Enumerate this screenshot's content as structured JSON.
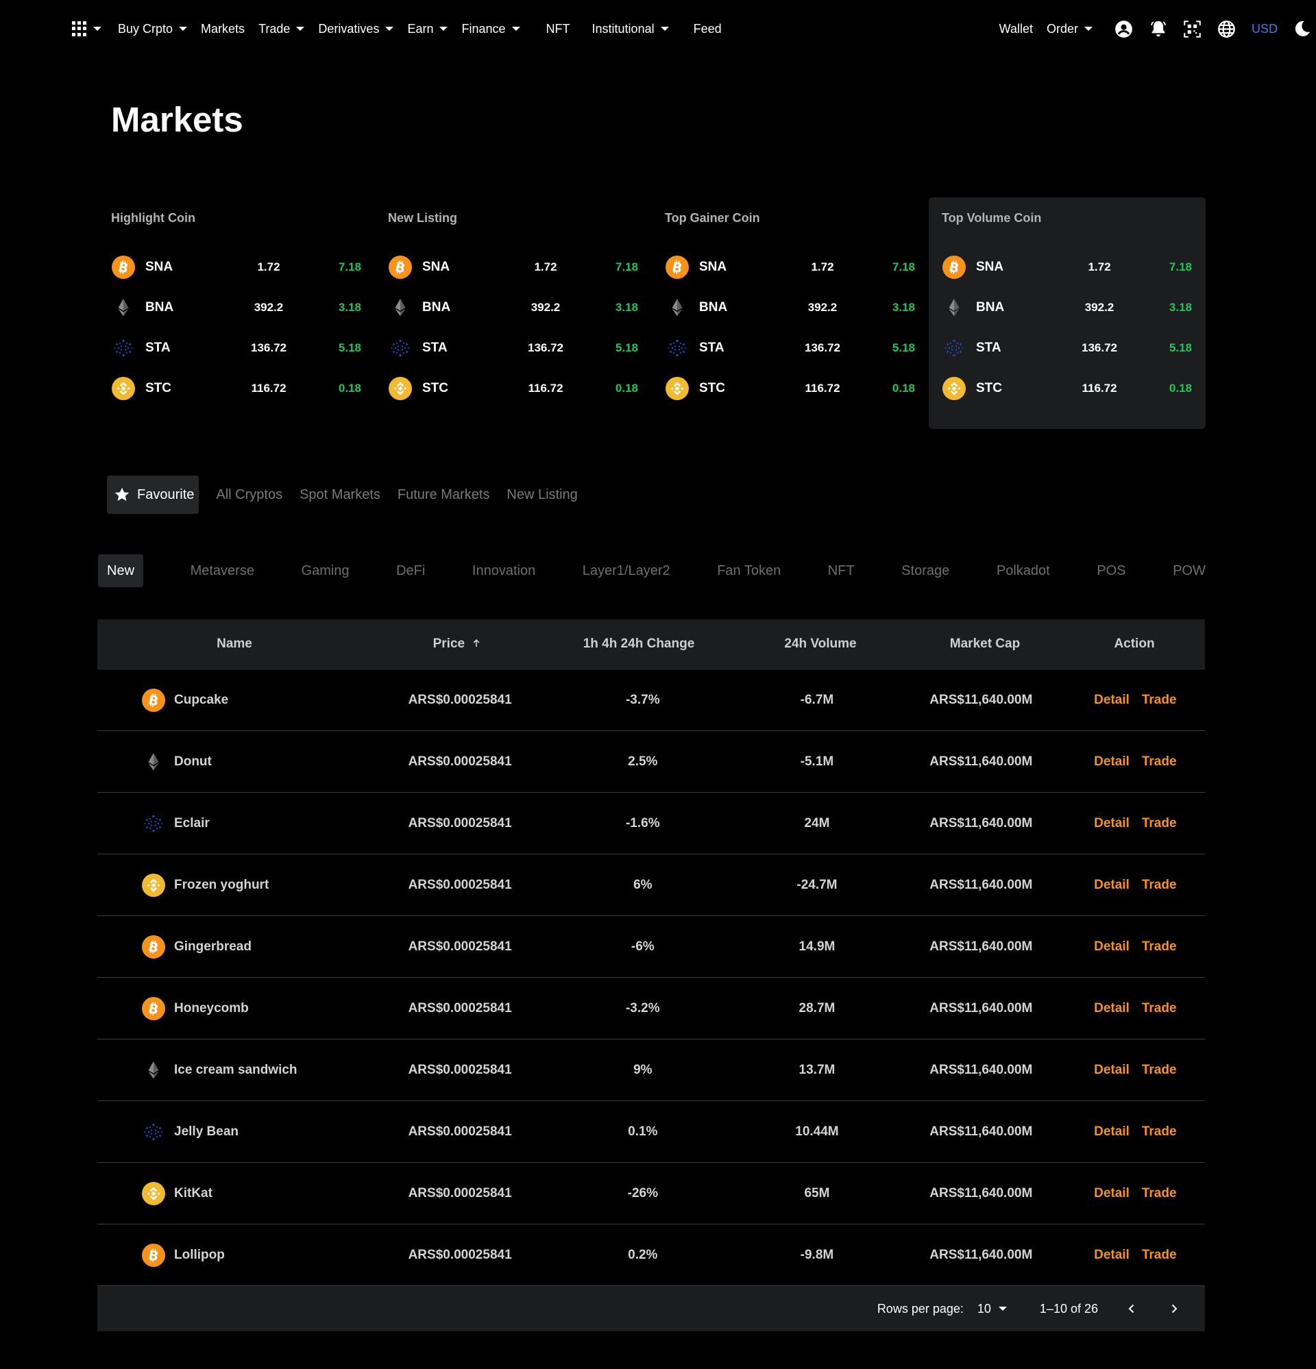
{
  "nav": {
    "items": [
      {
        "label": "Buy Crpto",
        "dropdown": true
      },
      {
        "label": "Markets",
        "dropdown": false
      },
      {
        "label": "Trade",
        "dropdown": true
      },
      {
        "label": "Derivatives",
        "dropdown": true
      },
      {
        "label": "Earn",
        "dropdown": true
      },
      {
        "label": "Finance",
        "dropdown": true
      },
      {
        "label": "NFT",
        "dropdown": false
      },
      {
        "label": "Institutional",
        "dropdown": true
      },
      {
        "label": "Feed",
        "dropdown": false
      }
    ],
    "wallet": "Wallet",
    "order": "Order",
    "currency": "USD",
    "currency_color": "#3d7cf2"
  },
  "page": {
    "title": "Markets"
  },
  "highlights": {
    "cards": [
      {
        "title": "Highlight Coin",
        "active": false
      },
      {
        "title": "New Listing",
        "active": false
      },
      {
        "title": "Top Gainer Coin",
        "active": false
      },
      {
        "title": "Top Volume Coin",
        "active": true
      }
    ],
    "coins": [
      {
        "icon": "bitcoin-icon",
        "symbol": "SNA",
        "price": "1.72",
        "change": "7.18"
      },
      {
        "icon": "ethereum-icon",
        "symbol": "BNA",
        "price": "392.2",
        "change": "3.18"
      },
      {
        "icon": "cardano-icon",
        "symbol": "STA",
        "price": "136.72",
        "change": "5.18"
      },
      {
        "icon": "binance-icon",
        "symbol": "STC",
        "price": "116.72",
        "change": "0.18"
      }
    ],
    "change_color": "#21c45d"
  },
  "market_tabs": {
    "items": [
      "Favourite",
      "All Cryptos",
      "Spot Markets",
      "Future Markets",
      "New Listing"
    ],
    "active": 0
  },
  "category_tabs": {
    "items": [
      "New",
      "Metaverse",
      "Gaming",
      "DeFi",
      "Innovation",
      "Layer1/Layer2",
      "Fan Token",
      "NFT",
      "Storage",
      "Polkadot",
      "POS",
      "POW"
    ],
    "active": 0
  },
  "table": {
    "headers": {
      "name": "Name",
      "price": "Price",
      "change": "1h 4h 24h Change",
      "volume": "24h Volume",
      "market_cap": "Market Cap",
      "action": "Action"
    },
    "sort_icon": "arrow-up-icon",
    "detail_label": "Detail",
    "trade_label": "Trade",
    "action_color": "#f7931a",
    "rows": [
      {
        "icon": "bitcoin-icon",
        "name": "Cupcake",
        "price": "ARS$0.00025841",
        "change": "-3.7%",
        "volume": "-6.7M",
        "market_cap": "ARS$11,640.00M"
      },
      {
        "icon": "ethereum-icon",
        "name": "Donut",
        "price": "ARS$0.00025841",
        "change": "2.5%",
        "volume": "-5.1M",
        "market_cap": "ARS$11,640.00M"
      },
      {
        "icon": "cardano-icon",
        "name": "Eclair",
        "price": "ARS$0.00025841",
        "change": "-1.6%",
        "volume": "24M",
        "market_cap": "ARS$11,640.00M"
      },
      {
        "icon": "binance-icon",
        "name": "Frozen yoghurt",
        "price": "ARS$0.00025841",
        "change": "6%",
        "volume": "-24.7M",
        "market_cap": "ARS$11,640.00M"
      },
      {
        "icon": "bitcoin-icon",
        "name": "Gingerbread",
        "price": "ARS$0.00025841",
        "change": "-6%",
        "volume": "14.9M",
        "market_cap": "ARS$11,640.00M"
      },
      {
        "icon": "bitcoin-icon",
        "name": "Honeycomb",
        "price": "ARS$0.00025841",
        "change": "-3.2%",
        "volume": "28.7M",
        "market_cap": "ARS$11,640.00M"
      },
      {
        "icon": "ethereum-icon",
        "name": "Ice cream sandwich",
        "price": "ARS$0.00025841",
        "change": "9%",
        "volume": "13.7M",
        "market_cap": "ARS$11,640.00M"
      },
      {
        "icon": "cardano-icon",
        "name": "Jelly Bean",
        "price": "ARS$0.00025841",
        "change": "0.1%",
        "volume": "10.44M",
        "market_cap": "ARS$11,640.00M"
      },
      {
        "icon": "binance-icon",
        "name": "KitKat",
        "price": "ARS$0.00025841",
        "change": "-26%",
        "volume": "65M",
        "market_cap": "ARS$11,640.00M"
      },
      {
        "icon": "bitcoin-icon",
        "name": "Lollipop",
        "price": "ARS$0.00025841",
        "change": "0.2%",
        "volume": "-9.8M",
        "market_cap": "ARS$11,640.00M"
      }
    ],
    "pagination": {
      "rows_per_page_label": "Rows per page:",
      "rows_per_page": "10",
      "range": "1–10 of 26"
    }
  }
}
